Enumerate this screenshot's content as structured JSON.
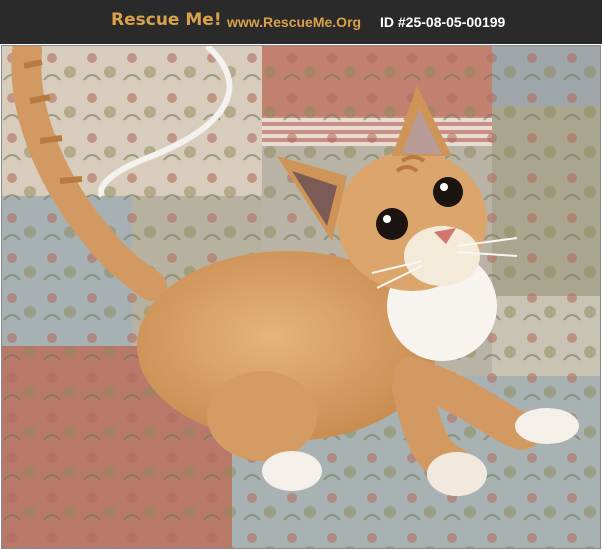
{
  "header": {
    "brand": "Rescue Me!",
    "site": "www.RescueMe.Org",
    "record_id": "ID #25-08-05-00199"
  },
  "photo": {
    "subject": "cat-photo"
  },
  "colors": {
    "header_bg": "#2a2a2a",
    "brand": "#d9a24a",
    "id_text": "#ffffff",
    "cat_fur": "#d9a36a"
  }
}
